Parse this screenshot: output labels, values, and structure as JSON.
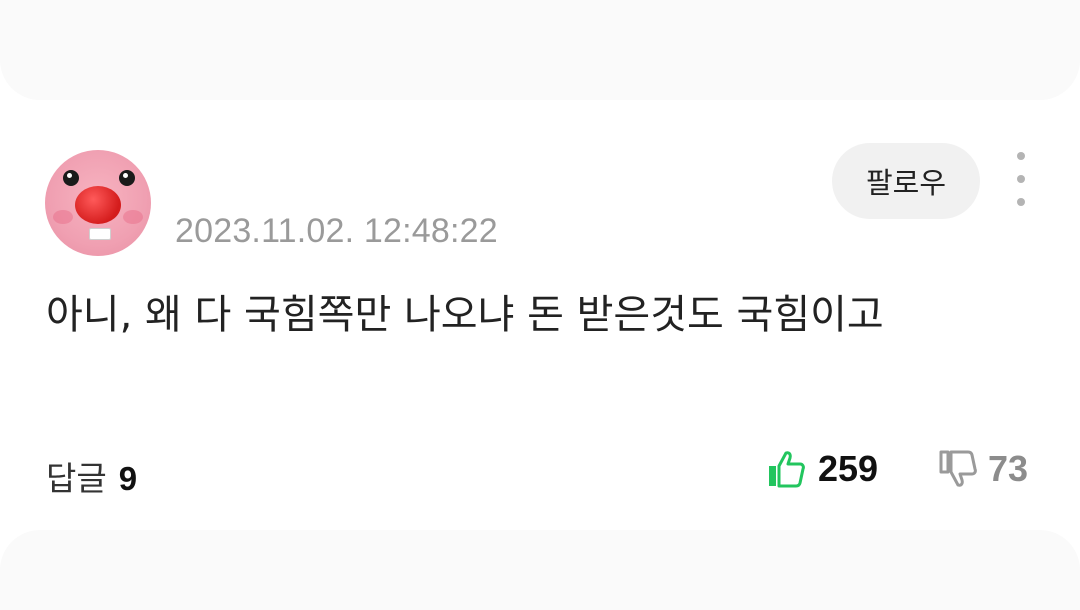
{
  "comment": {
    "timestamp": "2023.11.02. 12:48:22",
    "follow_label": "팔로우",
    "text": "아니, 왜 다 국힘쪽만 나오냐 돈 받은것도 국힘이고",
    "reply_label": "답글",
    "reply_count": "9",
    "like_count": "259",
    "dislike_count": "73"
  },
  "icons": {
    "avatar": "pink-creature-avatar",
    "more": "vertical-dots-icon",
    "like": "thumbs-up-icon",
    "dislike": "thumbs-down-icon"
  },
  "colors": {
    "like_icon": "#22c55e",
    "dislike_icon": "#9a9a9a",
    "timestamp": "#9a9a9a",
    "follow_bg": "#f1f1f1"
  }
}
